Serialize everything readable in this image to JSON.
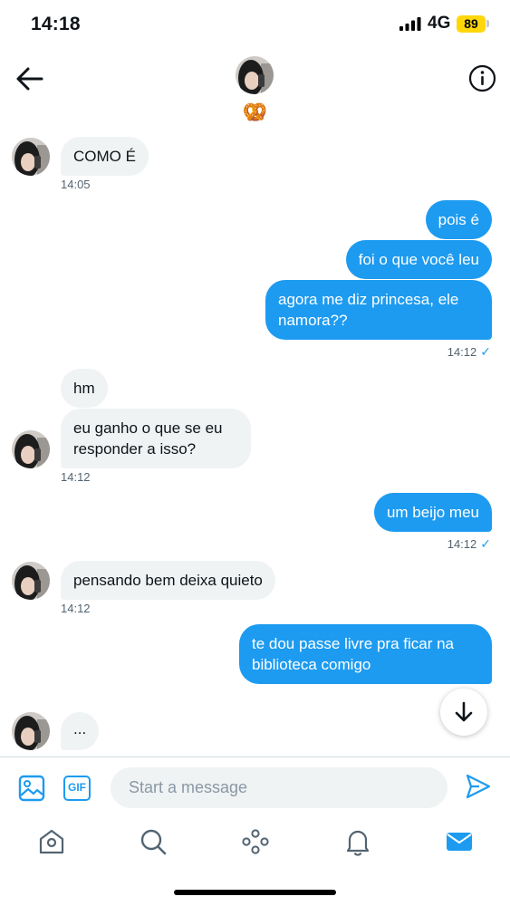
{
  "status_bar": {
    "time": "14:18",
    "network": "4G",
    "battery": "89"
  },
  "header": {
    "name_emoji": "🥨",
    "back_icon": "arrow-left-icon",
    "info_icon": "info-icon"
  },
  "messages": [
    {
      "side": "in",
      "text": "COMO É",
      "time": "14:05"
    },
    {
      "side": "out",
      "text": "pois é"
    },
    {
      "side": "out",
      "text": "foi o que você leu"
    },
    {
      "side": "out",
      "text": "agora me diz princesa, ele namora??",
      "time": "14:12"
    },
    {
      "side": "in",
      "text": "hm"
    },
    {
      "side": "in",
      "text": "eu ganho o que se eu responder a isso?",
      "time": "14:12"
    },
    {
      "side": "out",
      "text": "um beijo meu",
      "time": "14:12"
    },
    {
      "side": "in",
      "text": "pensando bem deixa quieto",
      "time": "14:12"
    },
    {
      "side": "out",
      "text": "te dou passe livre pra ficar na biblioteca comigo"
    },
    {
      "side": "in",
      "text": "..."
    }
  ],
  "composer": {
    "placeholder": "Start a message",
    "gif_label": "GIF"
  },
  "tabbar": [
    "home-icon",
    "search-icon",
    "communities-icon",
    "notifications-icon",
    "messages-icon"
  ],
  "colors": {
    "accent": "#1d9bf0",
    "incoming_bubble": "#eff3f4",
    "battery": "#ffd60a"
  }
}
